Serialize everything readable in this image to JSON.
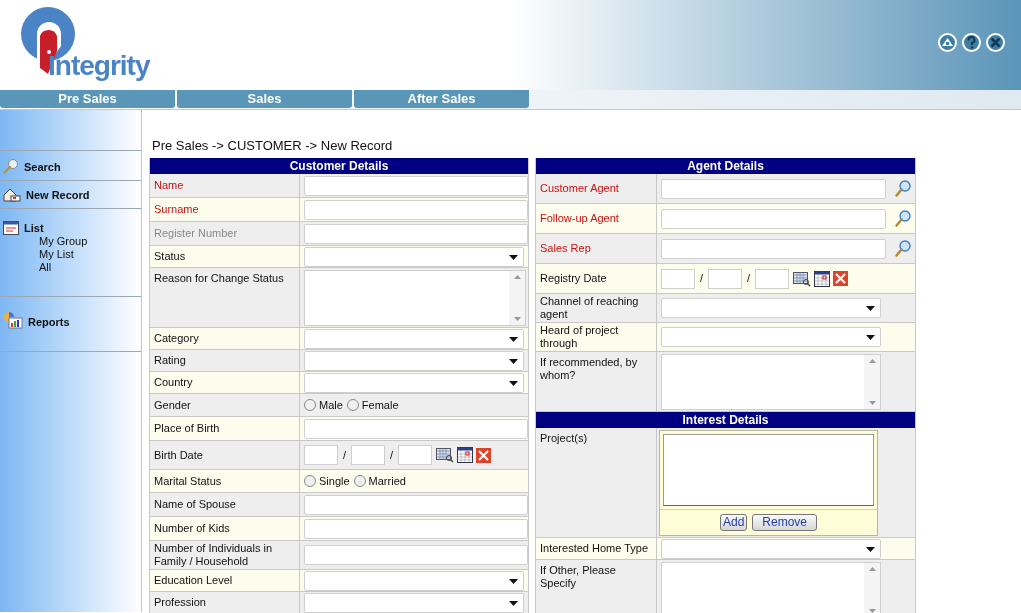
{
  "header": {
    "logo_text": "Integrity"
  },
  "tabs": [
    {
      "label": "Pre Sales"
    },
    {
      "label": "Sales"
    },
    {
      "label": "After Sales"
    }
  ],
  "sidebar": {
    "items": [
      {
        "label": "Search",
        "kind": "search"
      },
      {
        "label": "New Record",
        "kind": "record"
      },
      {
        "label": "List",
        "kind": "list",
        "children": [
          {
            "label": "My Group"
          },
          {
            "label": "My List"
          },
          {
            "label": "All"
          }
        ]
      },
      {
        "label": "Reports",
        "kind": "reports"
      }
    ]
  },
  "breadcrumb": "Pre Sales -> CUSTOMER -> New Record",
  "customer": {
    "title": "Customer Details",
    "rows": [
      {
        "label": "Name",
        "kind": "text",
        "required": true,
        "disabled": false
      },
      {
        "label": "Surname",
        "kind": "text",
        "required": true,
        "disabled": false
      },
      {
        "label": "Register Number",
        "kind": "text",
        "required": false,
        "disabled": true
      },
      {
        "label": "Status",
        "kind": "select",
        "required": false,
        "disabled": false
      },
      {
        "label": "Reason for Change Status",
        "kind": "textarea",
        "required": false,
        "disabled": false
      },
      {
        "label": "Category",
        "kind": "select",
        "required": false,
        "disabled": false
      },
      {
        "label": "Rating",
        "kind": "select",
        "required": false,
        "disabled": false
      },
      {
        "label": "Country",
        "kind": "select",
        "required": false,
        "disabled": false
      },
      {
        "label": "Gender",
        "kind": "radio",
        "required": false,
        "disabled": false,
        "options": [
          {
            "label": "Male",
            "selected": false
          },
          {
            "label": "Female",
            "selected": false
          }
        ]
      },
      {
        "label": "Place of Birth",
        "kind": "text",
        "required": false,
        "disabled": false
      },
      {
        "label": "Birth Date",
        "kind": "date",
        "required": false,
        "disabled": false,
        "separators": [
          "/",
          "/"
        ]
      },
      {
        "label": "Marital Status",
        "kind": "radio",
        "required": false,
        "disabled": false,
        "options": [
          {
            "label": "Single",
            "selected": false
          },
          {
            "label": "Married",
            "selected": false
          }
        ]
      },
      {
        "label": "Name of Spouse",
        "kind": "text",
        "required": false,
        "disabled": false
      },
      {
        "label": "Number of Kids",
        "kind": "text",
        "required": false,
        "disabled": false
      },
      {
        "label": "Number of Individuals in Family / Household",
        "kind": "text",
        "required": false,
        "disabled": false
      },
      {
        "label": "Education Level",
        "kind": "select",
        "required": false,
        "disabled": false
      },
      {
        "label": "Profession",
        "kind": "select",
        "required": false,
        "disabled": false
      }
    ]
  },
  "agent": {
    "title": "Agent Details",
    "rows": [
      {
        "label": "Customer Agent",
        "kind": "lookup",
        "required": true,
        "disabled": false
      },
      {
        "label": "Follow-up Agent",
        "kind": "lookup",
        "required": true,
        "disabled": false
      },
      {
        "label": "Sales Rep",
        "kind": "lookup",
        "required": true,
        "disabled": false
      },
      {
        "label": "Registry Date",
        "kind": "date",
        "required": false,
        "disabled": false,
        "separators": [
          "/",
          "/"
        ]
      },
      {
        "label": "Channel of reaching agent",
        "kind": "select",
        "required": false,
        "disabled": false
      },
      {
        "label": "Heard of project through",
        "kind": "select",
        "required": false,
        "disabled": false
      },
      {
        "label": "If recommended, by whom?",
        "kind": "textarea",
        "required": false,
        "disabled": false
      }
    ]
  },
  "interest": {
    "title": "Interest Details",
    "rows": [
      {
        "label": "Project(s)",
        "kind": "listbox",
        "required": false,
        "disabled": false,
        "buttons": [
          "Add",
          "Remove"
        ]
      },
      {
        "label": "Interested Home Type",
        "kind": "select",
        "required": false,
        "disabled": false
      },
      {
        "label": "If Other, Please Specify",
        "kind": "textarea",
        "required": false,
        "disabled": false
      }
    ]
  }
}
